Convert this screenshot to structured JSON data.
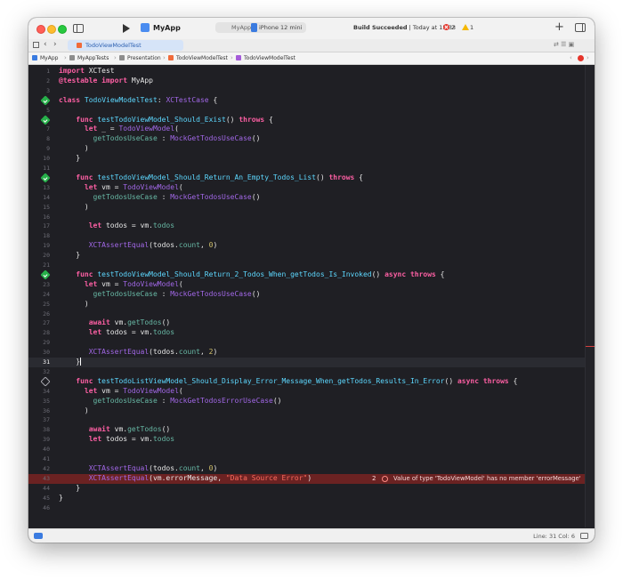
{
  "window": {
    "app_name": "MyApp",
    "scheme": "MyApp",
    "device": "iPhone 12 mini",
    "build_status_bold": "Build Succeeded",
    "build_status_rest": " | Today at 15:33",
    "error_count": "2",
    "warning_count": "1"
  },
  "tabbar": {
    "active_tab": "TodoViewModelTest",
    "right_icons": "⇄ ☰ ▣"
  },
  "breadcrumb": {
    "items": [
      "MyApp",
      "MyAppTests",
      "Presentation",
      "TodoViewModelTest",
      "TodoViewModelTest"
    ]
  },
  "editor": {
    "current_line": 31,
    "error_line": 43,
    "error_count": "2",
    "error_message": "Value of type 'TodoViewModel' has no member 'errorMessage'"
  },
  "statusbar": {
    "cursor_position": "Line: 31  Col: 6"
  },
  "colors": {
    "keyword": "#fc5fa3",
    "type": "#5dd8ff",
    "function": "#67b7a4",
    "string": "#fc6a5d",
    "number": "#d0bf69",
    "test_pass": "#27b04a",
    "error_line_bg": "#6b2222"
  },
  "icons": {
    "test_pass": "checkmark-diamond",
    "test_not_run": "empty-diamond",
    "error": "x-circle"
  }
}
